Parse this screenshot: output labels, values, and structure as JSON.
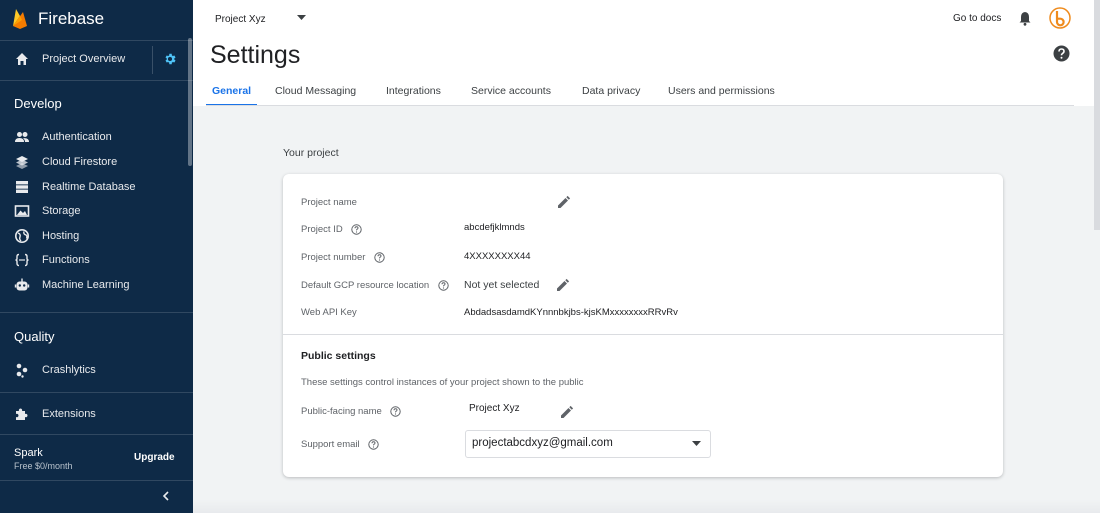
{
  "sidebar": {
    "brand": "Firebase",
    "project_overview": "Project Overview",
    "sections": [
      {
        "title": "Develop",
        "items": [
          {
            "label": "Authentication",
            "icon": "people-icon"
          },
          {
            "label": "Cloud Firestore",
            "icon": "firestore-icon"
          },
          {
            "label": "Realtime Database",
            "icon": "database-icon"
          },
          {
            "label": "Storage",
            "icon": "image-icon"
          },
          {
            "label": "Hosting",
            "icon": "globe-icon"
          },
          {
            "label": "Functions",
            "icon": "functions-icon"
          },
          {
            "label": "Machine Learning",
            "icon": "robot-icon"
          }
        ]
      },
      {
        "title": "Quality",
        "items": [
          {
            "label": "Crashlytics",
            "icon": "crashlytics-icon"
          }
        ]
      }
    ],
    "extensions": "Extensions",
    "plan": {
      "name": "Spark",
      "price": "Free $0/month",
      "upgrade": "Upgrade"
    }
  },
  "topbar": {
    "project": "Project Xyz",
    "go_to_docs": "Go to docs"
  },
  "header": {
    "title": "Settings",
    "tabs": [
      {
        "label": "General",
        "active": true
      },
      {
        "label": "Cloud Messaging",
        "active": false
      },
      {
        "label": "Integrations",
        "active": false
      },
      {
        "label": "Service accounts",
        "active": false
      },
      {
        "label": "Data privacy",
        "active": false
      },
      {
        "label": "Users and permissions",
        "active": false
      }
    ]
  },
  "your_project": {
    "title": "Your project",
    "rows": {
      "name_label": "Project name",
      "name_value": "",
      "id_label": "Project ID",
      "id_value": "abcdefjklmnds",
      "number_label": "Project number",
      "number_value": "4XXXXXXXX44",
      "location_label": "Default GCP resource location",
      "location_value": "Not yet selected",
      "api_label": "Web API Key",
      "api_value": "AbdadsasdamdKYnnnbkjbs-kjsKMxxxxxxxxRRvRv"
    }
  },
  "public_settings": {
    "title": "Public settings",
    "description": "These settings control instances of your project shown to the public",
    "public_name_label": "Public-facing name",
    "public_name_value": "Project Xyz",
    "support_email_label": "Support email",
    "support_email_value": "projectabcdxyz@gmail.com"
  },
  "colors": {
    "sidebar_bg": "#0e2a47",
    "accent": "#1a73e8",
    "firebase_orange": "#f5a623",
    "avatar_orange": "#ef8b1d"
  }
}
